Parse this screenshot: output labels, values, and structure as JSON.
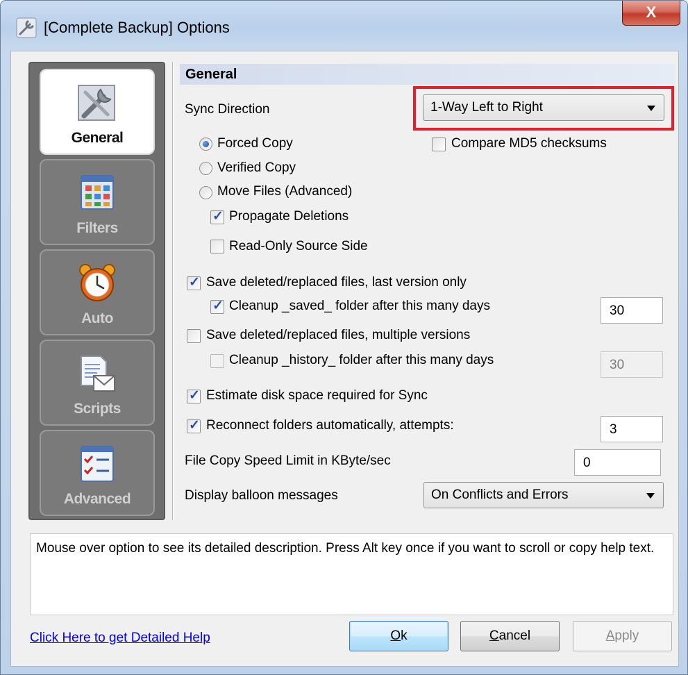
{
  "window": {
    "title": "[Complete Backup] Options",
    "close_label": "X"
  },
  "nav": {
    "items": [
      {
        "label": "General",
        "icon": "tools-icon",
        "active": true
      },
      {
        "label": "Filters",
        "icon": "filters-grid-icon",
        "active": false
      },
      {
        "label": "Auto",
        "icon": "alarm-clock-icon",
        "active": false
      },
      {
        "label": "Scripts",
        "icon": "script-mail-icon",
        "active": false
      },
      {
        "label": "Advanced",
        "icon": "checklist-icon",
        "active": false
      }
    ]
  },
  "general": {
    "header": "General",
    "sync_direction_label": "Sync Direction",
    "sync_direction_value": "1-Way Left to Right",
    "copy_modes": [
      {
        "label": "Forced Copy",
        "selected": true
      },
      {
        "label": "Verified Copy",
        "selected": false
      },
      {
        "label": "Move Files (Advanced)",
        "selected": false
      }
    ],
    "compare_md5": {
      "label": "Compare MD5 checksums",
      "checked": false
    },
    "propagate_deletions": {
      "label": "Propagate Deletions",
      "checked": true
    },
    "read_only_source": {
      "label": "Read-Only Source Side",
      "checked": false
    },
    "save_last_version": {
      "label": "Save deleted/replaced files, last version only",
      "checked": true
    },
    "cleanup_saved": {
      "label": "Cleanup _saved_ folder after this many days",
      "checked": true,
      "value": "30"
    },
    "save_multiple_versions": {
      "label": "Save deleted/replaced files, multiple versions",
      "checked": false
    },
    "cleanup_history": {
      "label": "Cleanup _history_ folder after this many days",
      "checked": false,
      "value": "30"
    },
    "estimate_disk_space": {
      "label": "Estimate disk space required for Sync",
      "checked": true
    },
    "reconnect_folders": {
      "label": "Reconnect folders automatically, attempts:",
      "checked": true,
      "value": "3"
    },
    "speed_limit_label": "File Copy Speed Limit in KByte/sec",
    "speed_limit_value": "0",
    "balloon_label": "Display balloon messages",
    "balloon_value": "On Conflicts and Errors"
  },
  "description": "Mouse over option to see its detailed description. Press Alt key once if you want to scroll or copy help text.",
  "footer": {
    "help_link": "Click Here to get Detailed Help",
    "ok_mnemonic": "O",
    "ok_rest": "k",
    "cancel_mnemonic": "C",
    "cancel_rest": "ancel",
    "apply_mnemonic": "A",
    "apply_rest": "pply"
  },
  "colors": {
    "highlight_border": "#e0202c",
    "nav_background": "#6e6e6e",
    "link": "#0000ee"
  }
}
